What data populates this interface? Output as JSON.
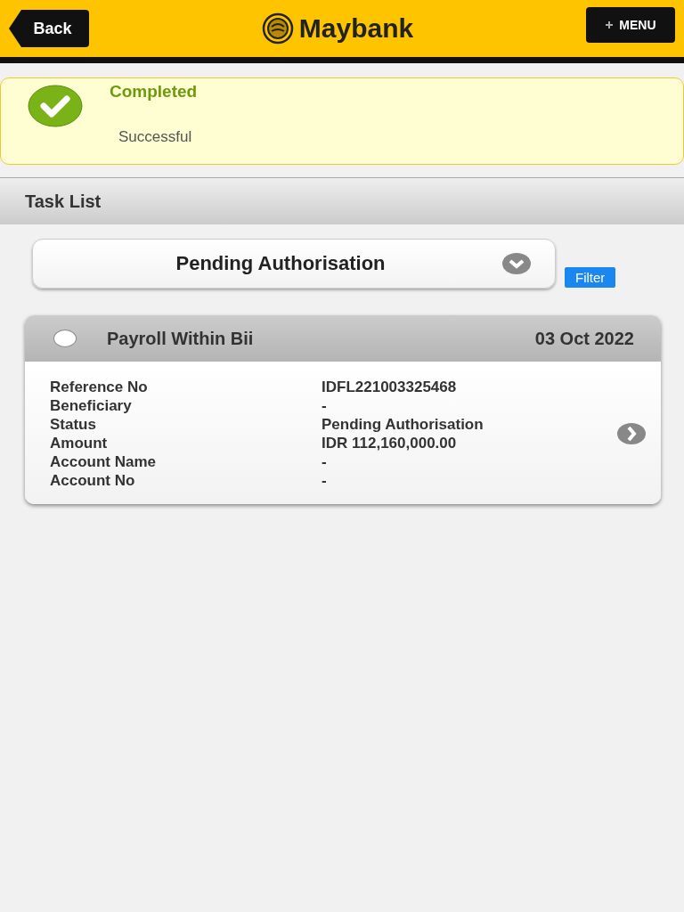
{
  "header": {
    "back": "Back",
    "logo": "Maybank",
    "menu": "MENU"
  },
  "notice": {
    "title": "Completed",
    "message": "Successful"
  },
  "section": {
    "title": "Task List"
  },
  "filter": {
    "value": "Pending Authorisation",
    "button": "Filter"
  },
  "tasks": [
    {
      "title": "Payroll Within Bii",
      "date": "03 Oct 2022",
      "selected": false,
      "fields": [
        {
          "label": "Reference No",
          "value": "IDFL221003325468"
        },
        {
          "label": "Beneficiary",
          "value": "-"
        },
        {
          "label": "Status",
          "value": "Pending Authorisation"
        },
        {
          "label": "Amount",
          "value": "IDR 112,160,000.00"
        },
        {
          "label": "Account Name",
          "value": "-"
        },
        {
          "label": "Account No",
          "value": "-"
        }
      ]
    }
  ]
}
